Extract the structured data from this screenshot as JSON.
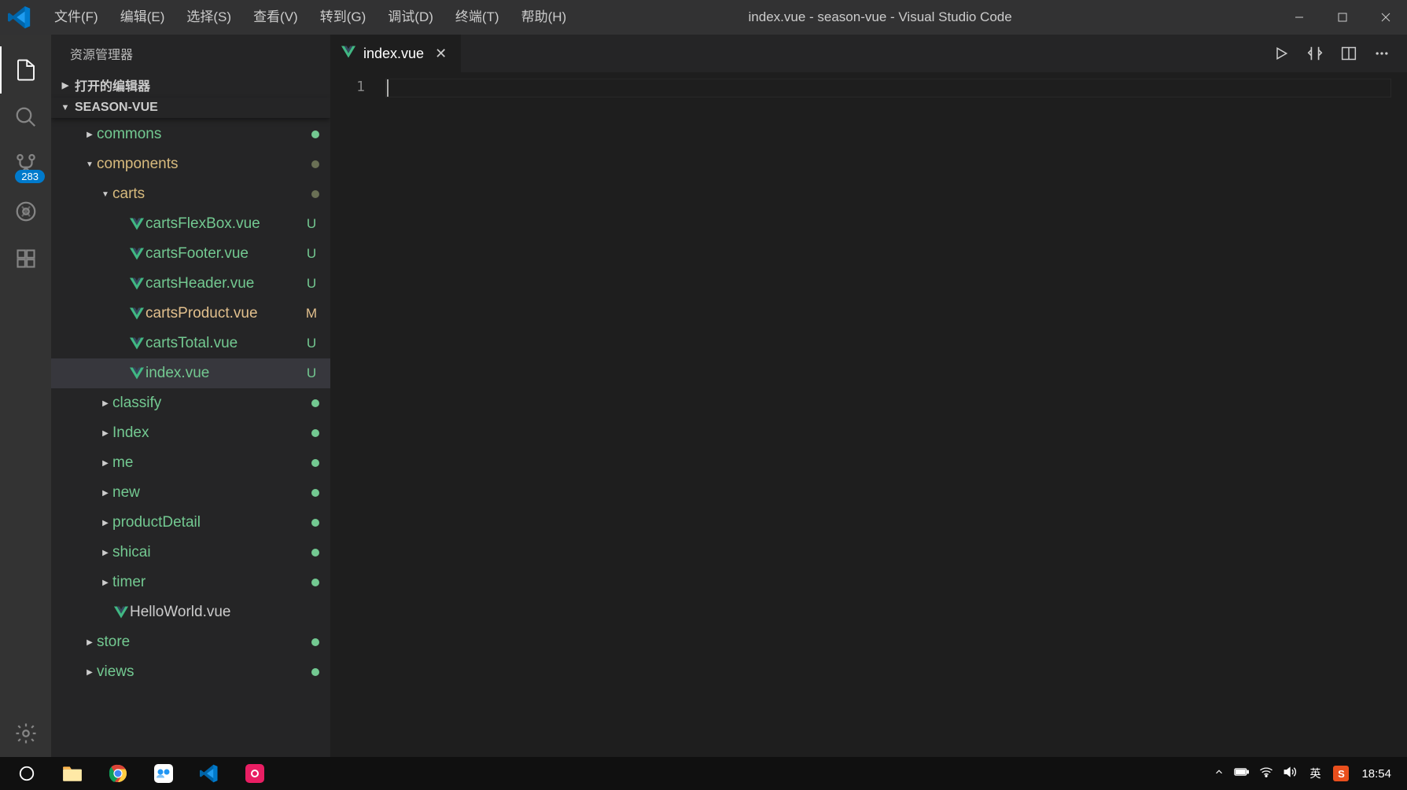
{
  "menubar": {
    "file": "文件(F)",
    "edit": "编辑(E)",
    "select": "选择(S)",
    "view": "查看(V)",
    "goto": "转到(G)",
    "debug": "调试(D)",
    "terminal": "终端(T)",
    "help": "帮助(H)"
  },
  "window_title": "index.vue - season-vue - Visual Studio Code",
  "sidebar": {
    "title": "资源管理器",
    "open_editors": "打开的编辑器",
    "project": "SEASON-VUE",
    "tree": {
      "commons": "commons",
      "components": "components",
      "carts": "carts",
      "cartsFlexBox": "cartsFlexBox.vue",
      "cartsFooter": "cartsFooter.vue",
      "cartsHeader": "cartsHeader.vue",
      "cartsProduct": "cartsProduct.vue",
      "cartsTotal": "cartsTotal.vue",
      "index": "index.vue",
      "classify": "classify",
      "Index": "Index",
      "me": "me",
      "new": "new",
      "productDetail": "productDetail",
      "shicai": "shicai",
      "timer": "timer",
      "HelloWorld": "HelloWorld.vue",
      "store": "store",
      "views": "views"
    },
    "status": {
      "U": "U",
      "M": "M"
    }
  },
  "scm_badge": "283",
  "tab": {
    "label": "index.vue"
  },
  "editor": {
    "line1": "1"
  },
  "taskbar": {
    "ime": "英",
    "sogou": "S",
    "clock": "18:54"
  }
}
